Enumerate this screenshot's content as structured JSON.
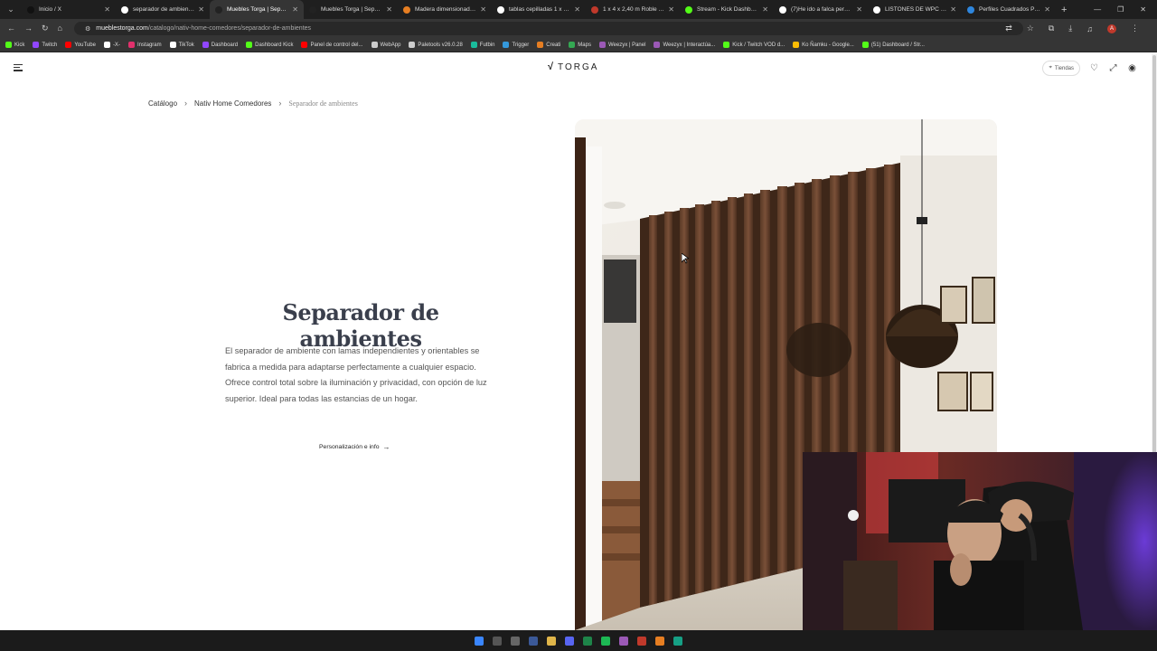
{
  "browser": {
    "tabs": [
      {
        "title": "Inicio / X",
        "color": "#111111"
      },
      {
        "title": "separador de ambientes",
        "color": "#ffffff"
      },
      {
        "title": "Muebles Torga | Separad",
        "color": "#222222",
        "active": true
      },
      {
        "title": "Muebles Torga | Separad",
        "color": "#222222"
      },
      {
        "title": "Madera dimensionada | S",
        "color": "#e67e22"
      },
      {
        "title": "tablas cepilladas 1 x 4 co",
        "color": "#ffffff"
      },
      {
        "title": "1 x 4 x 2,40 m Roble vapo",
        "color": "#c0392b"
      },
      {
        "title": "Stream - Kick Dashboard",
        "color": "#53fc18"
      },
      {
        "title": "(7)He ido a falca pero no",
        "color": "#ffffff"
      },
      {
        "title": "LISTONES DE WPC RECTA",
        "color": "#ffffff"
      },
      {
        "title": "Perfiles Cuadrados PVC S",
        "color": "#2e86de"
      }
    ],
    "url_host": "mueblestorga.com",
    "url_path": "/catalogo/nativ-home-comedores/separador-de-ambientes",
    "bookmarks": [
      {
        "label": "Kick",
        "color": "#53fc18"
      },
      {
        "label": "Twitch",
        "color": "#9146ff"
      },
      {
        "label": "YouTube",
        "color": "#ff0000"
      },
      {
        "label": "-X-",
        "color": "#ffffff"
      },
      {
        "label": "Instagram",
        "color": "#e1306c"
      },
      {
        "label": "TikTok",
        "color": "#ffffff"
      },
      {
        "label": "Dashboard",
        "color": "#9146ff"
      },
      {
        "label": "Dashboard Kick",
        "color": "#53fc18"
      },
      {
        "label": "Panel de control del...",
        "color": "#ff0000"
      },
      {
        "label": "WebApp",
        "color": "#cccccc"
      },
      {
        "label": "Paletools v26.0.28",
        "color": "#cccccc"
      },
      {
        "label": "Futbin",
        "color": "#1abc9c"
      },
      {
        "label": "Trigger",
        "color": "#3498db"
      },
      {
        "label": "Creati",
        "color": "#e67e22"
      },
      {
        "label": "Maps",
        "color": "#34a853"
      },
      {
        "label": "Weezyx | Panel",
        "color": "#9b59b6"
      },
      {
        "label": "Weezyx | Interactúa...",
        "color": "#9b59b6"
      },
      {
        "label": "Kick / Twitch VOD d...",
        "color": "#53fc18"
      },
      {
        "label": "Ko Ñamku - Google...",
        "color": "#fbbc05"
      },
      {
        "label": "(51) Dashboard / Str...",
        "color": "#53fc18"
      }
    ]
  },
  "site": {
    "logo": "TORGA",
    "stores_label": "Tiendas",
    "breadcrumb": [
      "Catálogo",
      "Nativ Home Comedores",
      "Separador de ambientes"
    ],
    "title": "Separador de ambientes",
    "description": "El separador de ambiente con lamas independientes y orientables se fabrica a medida para adaptarse perfectamente a cualquier espacio. Ofrece control total sobre la iluminación y privacidad, con opción de luz superior. Ideal para todas las estancias de un hogar.",
    "cta_label": "Personalización e info",
    "accent": "#3a3f4c"
  }
}
